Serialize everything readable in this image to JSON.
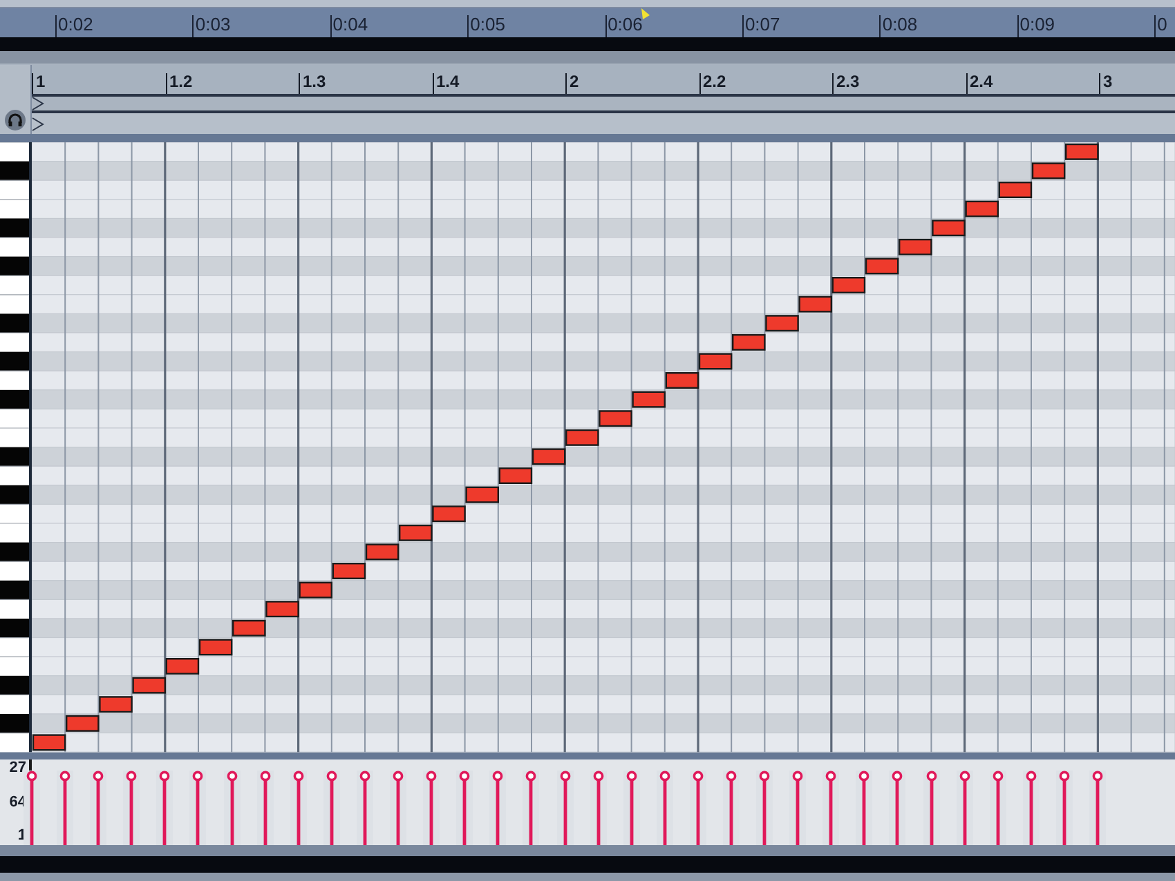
{
  "time_ruler": {
    "labels": [
      "0:02",
      "0:03",
      "0:04",
      "0:05",
      "0:06",
      "0:07",
      "0:08",
      "0:09",
      "0"
    ]
  },
  "beat_ruler": {
    "labels": [
      "1",
      "1.2",
      "1.3",
      "1.4",
      "2",
      "2.2",
      "2.3",
      "2.4",
      "3"
    ]
  },
  "velocity_lane": {
    "labels": [
      "27",
      "64",
      "1"
    ],
    "stems": [
      {
        "level": 1
      },
      {
        "level": 1
      },
      {
        "level": 1
      },
      {
        "level": 1
      },
      {
        "level": 1
      },
      {
        "level": 1
      },
      {
        "level": 1
      },
      {
        "level": 1
      },
      {
        "level": 1
      },
      {
        "level": 1
      },
      {
        "level": 1
      },
      {
        "level": 1
      },
      {
        "level": 1
      },
      {
        "level": 1
      },
      {
        "level": 1
      },
      {
        "level": 1
      },
      {
        "level": 1
      },
      {
        "level": 1
      },
      {
        "level": 1
      },
      {
        "level": 1
      },
      {
        "level": 1
      },
      {
        "level": 1
      },
      {
        "level": 1
      },
      {
        "level": 1
      },
      {
        "level": 1
      },
      {
        "level": 1
      },
      {
        "level": 1
      },
      {
        "level": 1
      },
      {
        "level": 1
      },
      {
        "level": 1
      },
      {
        "level": 1
      },
      {
        "level": 1
      },
      {
        "level": 1
      }
    ]
  }
}
